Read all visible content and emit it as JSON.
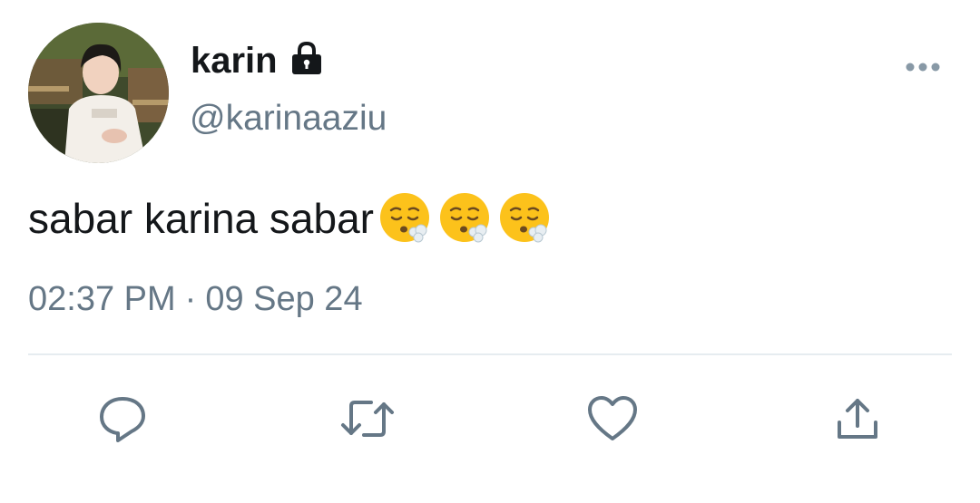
{
  "user": {
    "display_name": "karin",
    "handle": "@karinaaziu",
    "protected_icon": "lock-icon",
    "avatar_icon": "profile-photo"
  },
  "tweet": {
    "text": "sabar karina sabar",
    "emojis": [
      "face-exhaling-emoji",
      "face-exhaling-emoji",
      "face-exhaling-emoji"
    ],
    "time": "02:37 PM",
    "separator": "·",
    "date": "09 Sep 24"
  },
  "actions": [
    {
      "name": "reply",
      "icon": "reply-icon"
    },
    {
      "name": "retweet",
      "icon": "retweet-icon"
    },
    {
      "name": "like",
      "icon": "heart-icon"
    },
    {
      "name": "share",
      "icon": "share-icon"
    }
  ],
  "menu": {
    "icon": "more-icon"
  },
  "colors": {
    "text": "#14171a",
    "secondary": "#657786",
    "divider": "#e6ecf0",
    "emoji_face": "#fcc21b"
  }
}
